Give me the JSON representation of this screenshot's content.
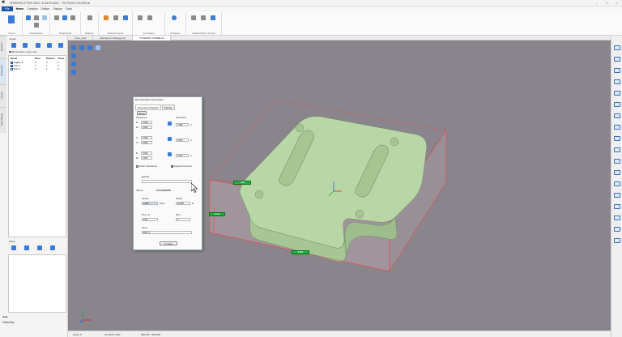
{
  "window": {
    "title": "SPEEDPLOTTER 2024 / 1024STUDIO · TS FRONT COVER.stl"
  },
  "menu": {
    "file": "File",
    "items": [
      "Home",
      "Creation",
      "Edition",
      "Display",
      "Tools"
    ]
  },
  "ribbon": {
    "groups": [
      "Import",
      "Visualization",
      "Snap/Grids",
      "Editions",
      "Measurements",
      "Annotation",
      "Analyses",
      "Collaboration / Export"
    ]
  },
  "doc_tabs": [
    "Front_bold",
    "Mechanism Manager.stl",
    "TS FRONT COVER.stl"
  ],
  "left_tabs": [
    "Explorer",
    "Properties",
    "Layers",
    "Clip Planes"
  ],
  "layers_panel": {
    "title": "Layers",
    "option": "Show Active Layer only",
    "columns": [
      "Name",
      "Num",
      "Models",
      "Views"
    ],
    "rows": [
      {
        "name": "Layer_0",
        "num": "0",
        "models": "0",
        "views": "2"
      },
      {
        "name": "Part 1",
        "num": "1",
        "models": "1",
        "views": "0"
      },
      {
        "name": "Part 2",
        "num": "1",
        "models": "1",
        "views": "0"
      }
    ]
  },
  "filters_panel": {
    "title": "Filters"
  },
  "help_panel": {
    "title": "Help",
    "text": "Standby"
  },
  "dialog": {
    "title": "Bounding Box Parameters",
    "tabs": [
      "Dimensions/Weight",
      "Display"
    ],
    "reset": "Reset",
    "allowances_label": "Allowances",
    "dimensions_label": "Dimensions",
    "axes": [
      {
        "neg": "X-",
        "neg_val": "0.000",
        "pos": "X+",
        "pos_val": "0.000",
        "dim_val": "7.080"
      },
      {
        "neg": "Y-",
        "neg_val": "0.000",
        "pos": "Y+",
        "pos_val": "0.000",
        "dim_val": "8.830"
      },
      {
        "neg": "Z-",
        "neg_val": "0.000",
        "pos": "Z+",
        "pos_val": "0.000",
        "dim_val": "2.134"
      }
    ],
    "unit": "in",
    "uniform": "Uniform Allowances",
    "display_dims": "Display Dimensions",
    "material_label": "Material",
    "volume_label": "Volume",
    "volume_val": "184.794893854",
    "density_label": "Density",
    "density_val": "0.000",
    "density_unit": "lb/in3",
    "weight_label": "Weight",
    "weight_val": "46.090",
    "weight_unit": "lb",
    "price_lb_label": "Price / lb",
    "price_lb_val": "0.00",
    "price_label": "Price",
    "price_val": "0",
    "name_label": "Name",
    "name_val": "BOX_1",
    "close": "Close"
  },
  "dimensions_3d": [
    "7.080",
    "2.134",
    "8.830"
  ],
  "status": {
    "layer": "Layer_0",
    "view": "Isometric View",
    "coords": "350.207 / 216.824"
  },
  "colors": {
    "viewport": "#8a848c",
    "part": "#b9d7a6",
    "bbox": "#e74a4a",
    "accent": "#1e56a8"
  }
}
